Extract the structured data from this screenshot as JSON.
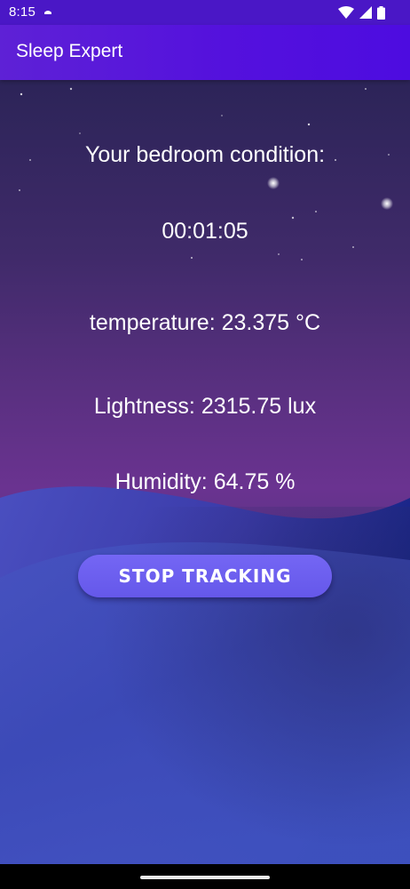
{
  "status_bar": {
    "time": "8:15",
    "icons": [
      "notification-icon",
      "wifi-icon",
      "signal-icon",
      "battery-icon"
    ]
  },
  "app_bar": {
    "title": "Sleep Expert"
  },
  "main": {
    "heading": "Your bedroom condition:",
    "timer": "00:01:05",
    "temperature": "temperature: 23.375 °C",
    "lightness": "Lightness: 2315.75 lux",
    "humidity": "Humidity: 64.75 %",
    "stop_button_label": "STOP TRACKING"
  },
  "colors": {
    "app_bar": "#5411dd",
    "button": "#6f62f0",
    "text": "#ffffff"
  }
}
